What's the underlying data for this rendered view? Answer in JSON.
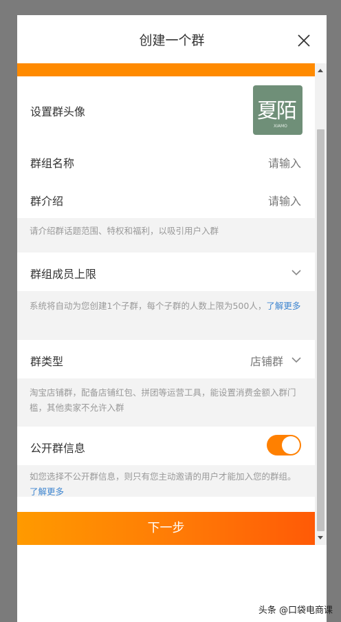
{
  "dialog": {
    "title": "创建一个群"
  },
  "avatar": {
    "label": "设置群头像",
    "image_text": "夏陌",
    "image_subtext": "XIAMO"
  },
  "name_row": {
    "label": "群组名称",
    "placeholder": "请输入"
  },
  "intro_row": {
    "label": "群介绍",
    "placeholder": "请输入"
  },
  "intro_hint": "请介绍群话题范围、特权和福利，以吸引用户入群",
  "limit_row": {
    "label": "群组成员上限"
  },
  "limit_hint": "系统将自动为您创建1个子群，每个子群的人数上限为500人，",
  "limit_hint_link": "了解更多",
  "type_row": {
    "label": "群类型",
    "value": "店铺群"
  },
  "type_hint": "淘宝店铺群，配备店铺红包、拼团等运营工具，能设置消费金额入群门槛，其他卖家不允许入群",
  "public_row": {
    "label": "公开群信息",
    "enabled": true
  },
  "public_hint": "如您选择不公开群信息，则只有您主动邀请的用户才能加入您的群组。",
  "public_hint_link": "了解更多",
  "next_button": "下一步",
  "watermark": "头条 @口袋电商课",
  "colors": {
    "accent": "#ff8a00",
    "link": "#3f86d0",
    "hint_bg": "#f3f3f3"
  }
}
